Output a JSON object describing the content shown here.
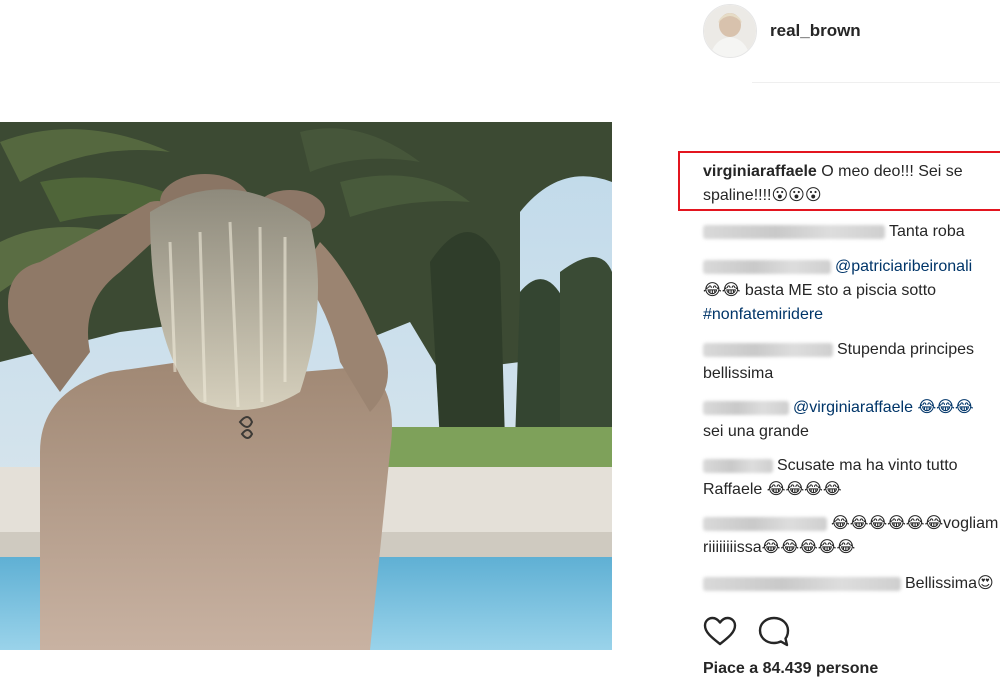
{
  "post": {
    "author": "real_brown",
    "photo_alt": "Post photo"
  },
  "comments": [
    {
      "user": "virginiaraffaele",
      "user_blurred": false,
      "lines": [
        "O meo deo!!! Sei se",
        "spaline!!!!😮😮😮"
      ],
      "highlighted": true
    },
    {
      "user_blurred": true,
      "blur_width": 182,
      "lines": [
        "Tanta roba"
      ]
    },
    {
      "user_blurred": true,
      "blur_width": 128,
      "mention": "@patriciaribeironali",
      "lines": [
        "😂😂 basta ME sto a piscia sotto"
      ],
      "hashtag": "#nonfatemiridere"
    },
    {
      "user_blurred": true,
      "blur_width": 130,
      "lines": [
        "Stupenda principes",
        "bellissima"
      ]
    },
    {
      "user_blurred": true,
      "blur_width": 86,
      "mention": "@virginiaraffaele 😂😂😂",
      "lines": [
        "sei una grande"
      ]
    },
    {
      "user_blurred": true,
      "blur_width": 70,
      "lines": [
        "Scusate ma ha vinto tutto",
        "Raffaele 😂😂😂😂"
      ]
    },
    {
      "user_blurred": true,
      "blur_width": 124,
      "lines": [
        "😂😂😂😂😂😂vogliam",
        "riiiiiiiissa😂😂😂😂😂"
      ]
    },
    {
      "user_blurred": true,
      "blur_width": 198,
      "lines": [
        "Bellissima😍"
      ]
    }
  ],
  "actions": {
    "like_icon": "heart-icon",
    "comment_icon": "comment-bubble-icon"
  },
  "likes_text": "Piace a 84.439 persone"
}
